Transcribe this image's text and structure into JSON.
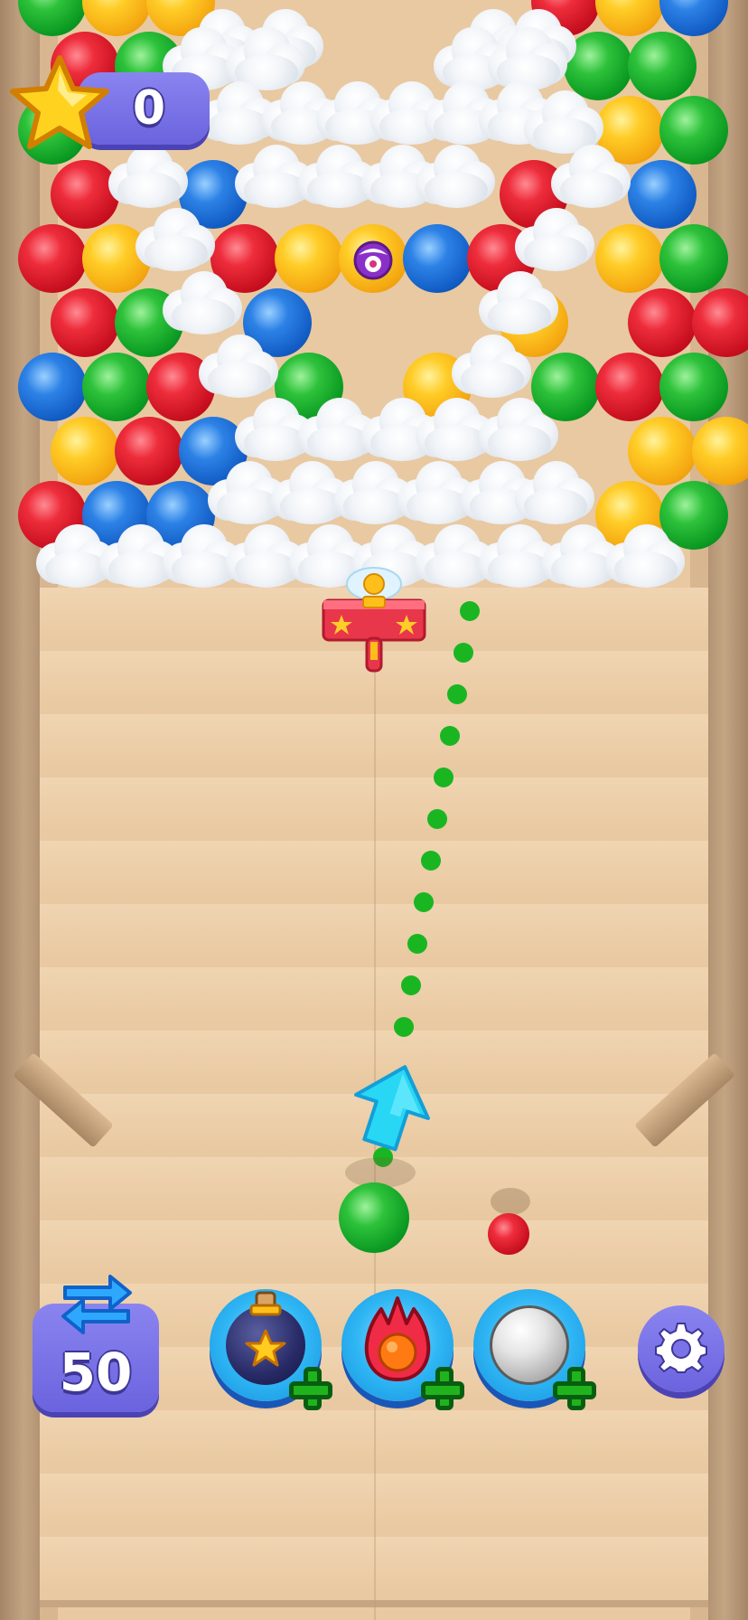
{
  "hud": {
    "score_value": "0",
    "moves_value": "50"
  },
  "icons": {
    "score": "star-icon",
    "moves": "swap-arrows-icon",
    "booster_1": "bomb-icon",
    "booster_2": "fireball-icon",
    "booster_3": "silver-ball-icon",
    "add": "plus-icon",
    "settings": "gear-icon",
    "aim_direction": "up-arrow-icon"
  },
  "colors": {
    "red": "#e61e2e",
    "yellow": "#ffbf1a",
    "green": "#16a52a",
    "blue": "#1f6fd6",
    "aim_dots": "#19b622",
    "hud_purple": "#7a73e8"
  },
  "game": {
    "current_bubble_color": "green",
    "next_bubble_color": "red",
    "bubble_rows": [
      [
        "green",
        "yellow",
        "yellow",
        "",
        "",
        "",
        "",
        "",
        "red",
        "yellow",
        "blue"
      ],
      [
        "red",
        "green",
        "",
        "",
        "",
        "",
        "",
        "",
        "green",
        "green"
      ],
      [
        "green",
        "",
        "",
        "",
        "",
        "",
        "",
        "",
        "",
        "yellow",
        "green"
      ],
      [
        "red",
        "",
        "blue",
        "",
        "",
        "",
        "",
        "red",
        "",
        "blue"
      ],
      [
        "red",
        "yellow",
        "",
        "red",
        "yellow",
        "special",
        "blue",
        "red",
        "",
        "yellow",
        "green"
      ],
      [
        "red",
        "green",
        "",
        "blue",
        "",
        "",
        "",
        "yellow",
        "",
        "red",
        "red"
      ],
      [
        "blue",
        "green",
        "red",
        "",
        "green",
        "",
        "yellow",
        "",
        "green",
        "red",
        "green"
      ],
      [
        "yellow",
        "red",
        "blue",
        "",
        "",
        "",
        "",
        "",
        "",
        "yellow",
        "yellow"
      ],
      [
        "red",
        "blue",
        "blue",
        "",
        "",
        "",
        "",
        "",
        "",
        "yellow",
        "green"
      ]
    ]
  }
}
